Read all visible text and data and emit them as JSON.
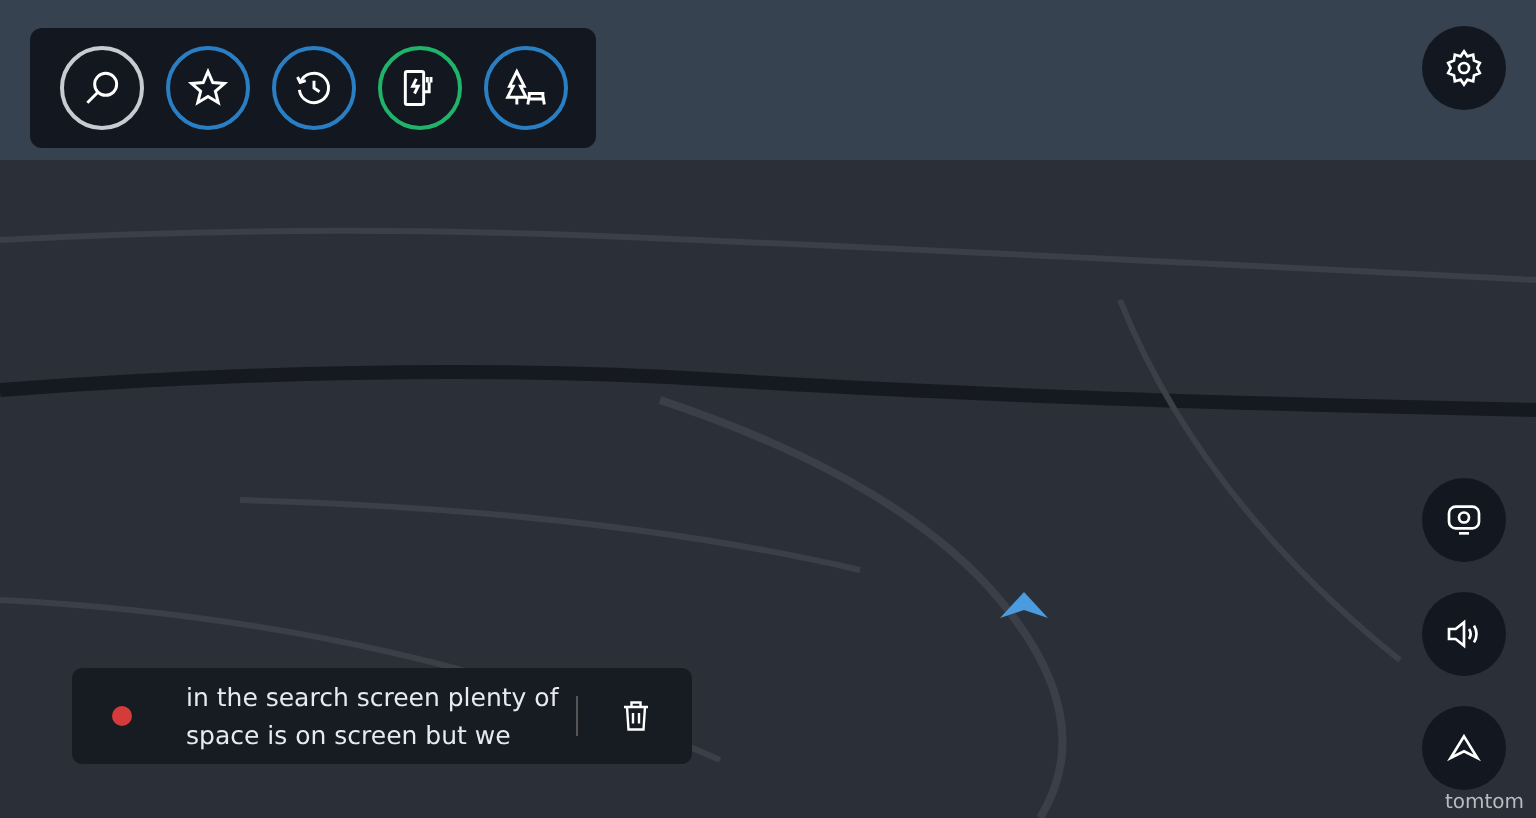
{
  "toolbar": {
    "buttons": [
      {
        "kind": "search",
        "color": "#c8ccd2"
      },
      {
        "kind": "favorites",
        "color": "#2a7fc4"
      },
      {
        "kind": "recent",
        "color": "#2a7fc4"
      },
      {
        "kind": "charging",
        "color": "#1fb46a"
      },
      {
        "kind": "parking",
        "color": "#2a7fc4"
      }
    ]
  },
  "map_controls": [
    {
      "kind": "camera"
    },
    {
      "kind": "volume"
    },
    {
      "kind": "navigate"
    }
  ],
  "note": {
    "recording": true,
    "text": "in the search screen plenty of space is on screen but we"
  },
  "logo": "tomtom"
}
